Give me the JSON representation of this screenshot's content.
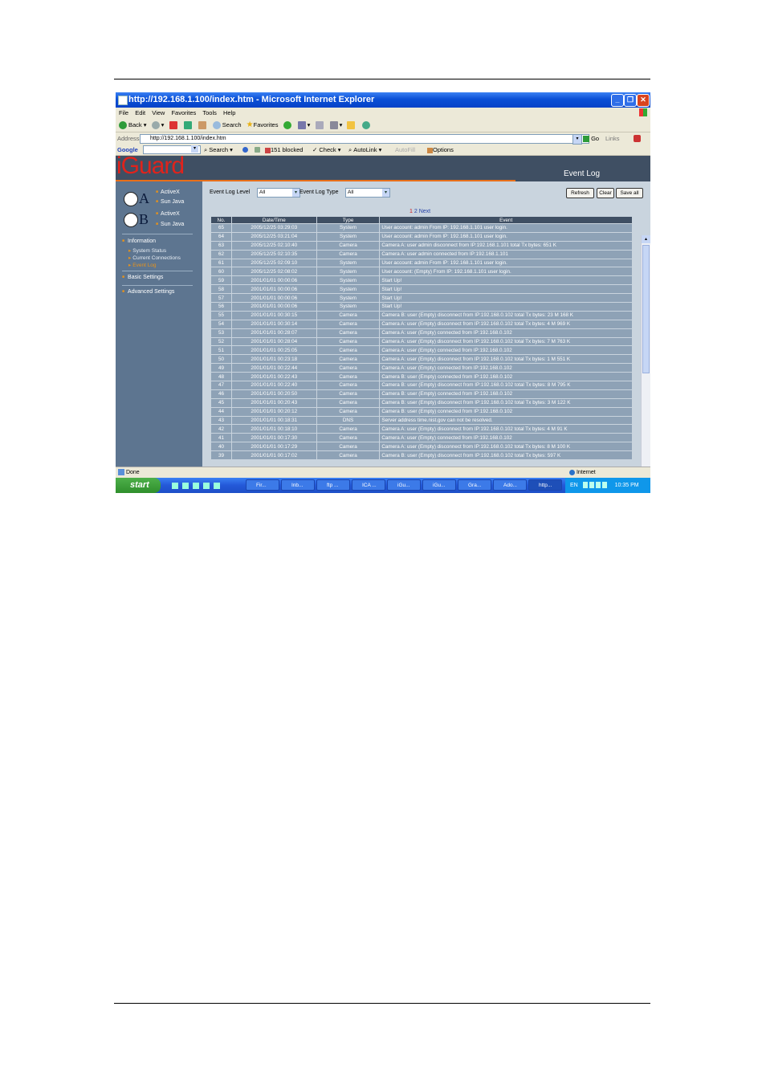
{
  "browser": {
    "title": "http://192.168.1.100/index.htm - Microsoft Internet Explorer",
    "menu": [
      "File",
      "Edit",
      "View",
      "Favorites",
      "Tools",
      "Help"
    ],
    "toolbar": {
      "back": "Back",
      "search": "Search",
      "favorites": "Favorites"
    },
    "address_label": "Address",
    "address_value": "http://192.168.1.100/index.htm",
    "go": "Go",
    "links": "Links",
    "googlebar": {
      "brand": "Google",
      "search": "Search",
      "blocked": "151 blocked",
      "check": "Check",
      "autolink": "AutoLink",
      "autofill": "AutoFill",
      "options": "Options"
    },
    "status_text": "Done",
    "status_zone": "Internet"
  },
  "app": {
    "logo": "iGuard",
    "page_title": "Event Log",
    "sidebar": {
      "camera_a_links": [
        "ActiveX",
        "Sun Java"
      ],
      "camera_b_links": [
        "ActiveX",
        "Sun Java"
      ],
      "camera_a_letter": "A",
      "camera_b_letter": "B",
      "information": "Information",
      "information_items": [
        "System Status",
        "Current Connections",
        "Event Log"
      ],
      "basic_settings": "Basic Settings",
      "advanced_settings": "Advanced Settings"
    },
    "filters": {
      "level_label": "Event Log Level",
      "level_value": "All",
      "type_label": "Event Log Type",
      "type_value": "All"
    },
    "buttons": {
      "refresh": "Refresh",
      "clear": "Clear",
      "save_all": "Save all"
    },
    "pager": {
      "page1": "1",
      "page2": "2",
      "next": "Next"
    },
    "table": {
      "headers": [
        "No.",
        "Date/Time",
        "Type",
        "Event"
      ],
      "rows": [
        [
          "65",
          "2005/12/25 03:29:03",
          "System",
          "User account: admin From IP: 192.168.1.101 user login."
        ],
        [
          "64",
          "2005/12/25 03:21:04",
          "System",
          "User account: admin From IP: 192.168.1.101 user login."
        ],
        [
          "63",
          "2005/12/25 02:10:40",
          "Camera",
          "Camera A: user admin disconnect from IP:192.168.1.101 total Tx bytes: 651 K"
        ],
        [
          "62",
          "2005/12/25 02:10:35",
          "Camera",
          "Camera A: user admin connected from IP:192.168.1.101"
        ],
        [
          "61",
          "2005/12/25 02:09:10",
          "System",
          "User account: admin From IP: 192.168.1.101 user login."
        ],
        [
          "60",
          "2005/12/25 02:08:02",
          "System",
          "User account: (Empty) From IP: 192.168.1.101 user login."
        ],
        [
          "59",
          "2001/01/01 00:00:06",
          "System",
          "Start Up!"
        ],
        [
          "58",
          "2001/01/01 00:00:06",
          "System",
          "Start Up!"
        ],
        [
          "57",
          "2001/01/01 00:00:06",
          "System",
          "Start Up!"
        ],
        [
          "56",
          "2001/01/01 00:00:06",
          "System",
          "Start Up!"
        ],
        [
          "55",
          "2001/01/01 00:30:15",
          "Camera",
          "Camera B: user (Empty) disconnect from IP:192.168.0.102 total Tx bytes: 23 M 168 K"
        ],
        [
          "54",
          "2001/01/01 00:30:14",
          "Camera",
          "Camera A: user (Empty) disconnect from IP:192.168.0.102 total Tx bytes: 4 M 969 K"
        ],
        [
          "53",
          "2001/01/01 00:28:07",
          "Camera",
          "Camera A: user (Empty) connected from IP:192.168.0.102"
        ],
        [
          "52",
          "2001/01/01 00:28:04",
          "Camera",
          "Camera A: user (Empty) disconnect from IP:192.168.0.102 total Tx bytes: 7 M 763 K"
        ],
        [
          "51",
          "2001/01/01 00:25:05",
          "Camera",
          "Camera A: user (Empty) connected from IP:192.168.0.102"
        ],
        [
          "50",
          "2001/01/01 00:23:18",
          "Camera",
          "Camera A: user (Empty) disconnect from IP:192.168.0.102 total Tx bytes: 1 M 551 K"
        ],
        [
          "49",
          "2001/01/01 00:22:44",
          "Camera",
          "Camera A: user (Empty) connected from IP:192.168.0.102"
        ],
        [
          "48",
          "2001/01/01 00:22:43",
          "Camera",
          "Camera B: user (Empty) connected from IP:192.168.0.102"
        ],
        [
          "47",
          "2001/01/01 00:22:40",
          "Camera",
          "Camera B: user (Empty) disconnect from IP:192.168.0.102 total Tx bytes: 8 M 795 K"
        ],
        [
          "46",
          "2001/01/01 00:20:50",
          "Camera",
          "Camera B: user (Empty) connected from IP:192.168.0.102"
        ],
        [
          "45",
          "2001/01/01 00:20:43",
          "Camera",
          "Camera B: user (Empty) disconnect from IP:192.168.0.102 total Tx bytes: 3 M 122 K"
        ],
        [
          "44",
          "2001/01/01 00:20:12",
          "Camera",
          "Camera B: user (Empty) connected from IP:192.168.0.102"
        ],
        [
          "43",
          "2001/01/01 00:18:31",
          "DNS",
          "Server address time.nist.gov can not be resolved."
        ],
        [
          "42",
          "2001/01/01 00:18:10",
          "Camera",
          "Camera A: user (Empty) disconnect from IP:192.168.0.102 total Tx bytes: 4 M 91 K"
        ],
        [
          "41",
          "2001/01/01 00:17:30",
          "Camera",
          "Camera A: user (Empty) connected from IP:192.168.0.102"
        ],
        [
          "40",
          "2001/01/01 00:17:29",
          "Camera",
          "Camera A: user (Empty) disconnect from IP:192.168.0.102 total Tx bytes: 8 M 100 K"
        ],
        [
          "39",
          "2001/01/01 00:17:02",
          "Camera",
          "Camera B: user (Empty) disconnect from IP:192.168.0.102 total Tx bytes: 597 K"
        ]
      ]
    }
  },
  "taskbar": {
    "start": "start",
    "tasks": [
      "Fir...",
      "Inb...",
      "ftp ...",
      "ICA ...",
      "iGu...",
      "iGu...",
      "Gra...",
      "Ado...",
      "http..."
    ],
    "language": "EN",
    "clock": "10:35 PM"
  },
  "colors": {
    "banner": "#3f4f63",
    "logo_red": "#e0231c",
    "accent_orange": "#e86f1a",
    "sidebar": "#5d7590",
    "row": "#8ea2b6"
  }
}
